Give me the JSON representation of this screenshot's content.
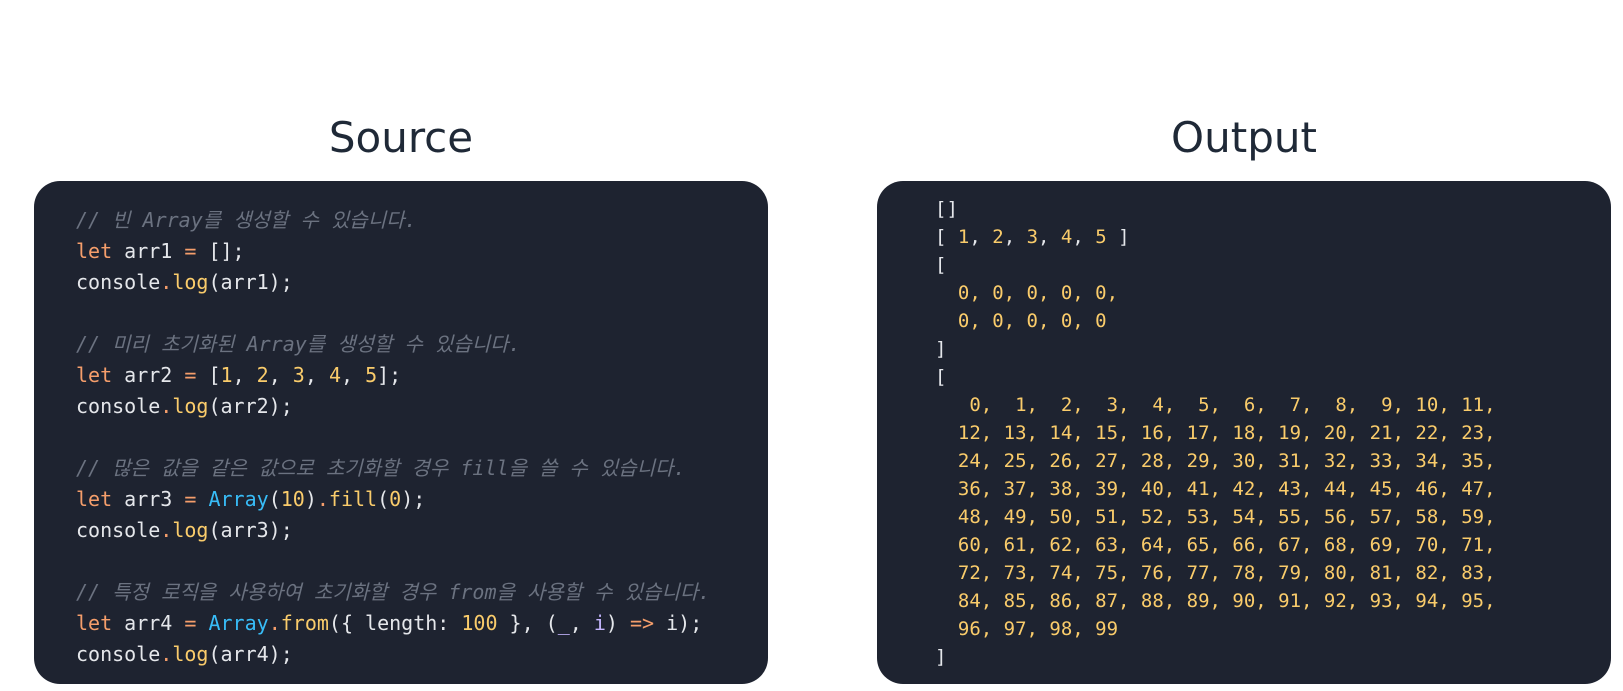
{
  "titles": {
    "source": "Source",
    "output": "Output"
  },
  "source_lines": [
    [
      {
        "t": "// 빈 Array를 생성할 수 있습니다.",
        "c": "cm"
      }
    ],
    [
      {
        "t": "let",
        "c": "kw"
      },
      {
        "t": " arr1 ",
        "c": "txt"
      },
      {
        "t": "=",
        "c": "op"
      },
      {
        "t": " [];",
        "c": "txt"
      }
    ],
    [
      {
        "t": "console",
        "c": "txt"
      },
      {
        "t": ".",
        "c": "op"
      },
      {
        "t": "log",
        "c": "fn"
      },
      {
        "t": "(arr1);",
        "c": "txt"
      }
    ],
    [],
    [
      {
        "t": "// 미리 초기화된 Array를 생성할 수 있습니다.",
        "c": "cm"
      }
    ],
    [
      {
        "t": "let",
        "c": "kw"
      },
      {
        "t": " arr2 ",
        "c": "txt"
      },
      {
        "t": "=",
        "c": "op"
      },
      {
        "t": " [",
        "c": "txt"
      },
      {
        "t": "1",
        "c": "num"
      },
      {
        "t": ", ",
        "c": "txt"
      },
      {
        "t": "2",
        "c": "num"
      },
      {
        "t": ", ",
        "c": "txt"
      },
      {
        "t": "3",
        "c": "num"
      },
      {
        "t": ", ",
        "c": "txt"
      },
      {
        "t": "4",
        "c": "num"
      },
      {
        "t": ", ",
        "c": "txt"
      },
      {
        "t": "5",
        "c": "num"
      },
      {
        "t": "];",
        "c": "txt"
      }
    ],
    [
      {
        "t": "console",
        "c": "txt"
      },
      {
        "t": ".",
        "c": "op"
      },
      {
        "t": "log",
        "c": "fn"
      },
      {
        "t": "(arr2);",
        "c": "txt"
      }
    ],
    [],
    [
      {
        "t": "// 많은 값을 같은 값으로 초기화할 경우 fill을 쓸 수 있습니다.",
        "c": "cm"
      }
    ],
    [
      {
        "t": "let",
        "c": "kw"
      },
      {
        "t": " arr3 ",
        "c": "txt"
      },
      {
        "t": "=",
        "c": "op"
      },
      {
        "t": " ",
        "c": "txt"
      },
      {
        "t": "Array",
        "c": "cls"
      },
      {
        "t": "(",
        "c": "txt"
      },
      {
        "t": "10",
        "c": "num"
      },
      {
        "t": ")",
        "c": "txt"
      },
      {
        "t": ".",
        "c": "op"
      },
      {
        "t": "fill",
        "c": "fn"
      },
      {
        "t": "(",
        "c": "txt"
      },
      {
        "t": "0",
        "c": "num"
      },
      {
        "t": ");",
        "c": "txt"
      }
    ],
    [
      {
        "t": "console",
        "c": "txt"
      },
      {
        "t": ".",
        "c": "op"
      },
      {
        "t": "log",
        "c": "fn"
      },
      {
        "t": "(arr3);",
        "c": "txt"
      }
    ],
    [],
    [
      {
        "t": "// 특정 로직을 사용하여 초기화할 경우 from을 사용할 수 있습니다.",
        "c": "cm"
      }
    ],
    [
      {
        "t": "let",
        "c": "kw"
      },
      {
        "t": " arr4 ",
        "c": "txt"
      },
      {
        "t": "=",
        "c": "op"
      },
      {
        "t": " ",
        "c": "txt"
      },
      {
        "t": "Array",
        "c": "cls"
      },
      {
        "t": ".",
        "c": "op"
      },
      {
        "t": "from",
        "c": "fn"
      },
      {
        "t": "({ length: ",
        "c": "txt"
      },
      {
        "t": "100",
        "c": "num"
      },
      {
        "t": " }, (",
        "c": "txt"
      },
      {
        "t": "_",
        "c": "var"
      },
      {
        "t": ", ",
        "c": "txt"
      },
      {
        "t": "i",
        "c": "var"
      },
      {
        "t": ") ",
        "c": "txt"
      },
      {
        "t": "=>",
        "c": "op"
      },
      {
        "t": " i);",
        "c": "txt"
      }
    ],
    [
      {
        "t": "console",
        "c": "txt"
      },
      {
        "t": ".",
        "c": "op"
      },
      {
        "t": "log",
        "c": "fn"
      },
      {
        "t": "(arr4);",
        "c": "txt"
      }
    ]
  ],
  "output_lines": [
    [
      {
        "t": "[]",
        "c": "txt"
      }
    ],
    [
      {
        "t": "[ ",
        "c": "txt"
      },
      {
        "t": "1",
        "c": "num"
      },
      {
        "t": ", ",
        "c": "txt"
      },
      {
        "t": "2",
        "c": "num"
      },
      {
        "t": ", ",
        "c": "txt"
      },
      {
        "t": "3",
        "c": "num"
      },
      {
        "t": ", ",
        "c": "txt"
      },
      {
        "t": "4",
        "c": "num"
      },
      {
        "t": ", ",
        "c": "txt"
      },
      {
        "t": "5",
        "c": "num"
      },
      {
        "t": " ]",
        "c": "txt"
      }
    ],
    [
      {
        "t": "[",
        "c": "txt"
      }
    ],
    [
      {
        "t": "  0, 0, 0, 0, 0,",
        "c": "num"
      }
    ],
    [
      {
        "t": "  0, 0, 0, 0, 0",
        "c": "num"
      }
    ],
    [
      {
        "t": "]",
        "c": "txt"
      }
    ],
    [
      {
        "t": "[",
        "c": "txt"
      }
    ],
    [
      {
        "t": "   0,  1,  2,  3,  4,  5,  6,  7,  8,  9, 10, 11,",
        "c": "num"
      }
    ],
    [
      {
        "t": "  12, 13, 14, 15, 16, 17, 18, 19, 20, 21, 22, 23,",
        "c": "num"
      }
    ],
    [
      {
        "t": "  24, 25, 26, 27, 28, 29, 30, 31, 32, 33, 34, 35,",
        "c": "num"
      }
    ],
    [
      {
        "t": "  36, 37, 38, 39, 40, 41, 42, 43, 44, 45, 46, 47,",
        "c": "num"
      }
    ],
    [
      {
        "t": "  48, 49, 50, 51, 52, 53, 54, 55, 56, 57, 58, 59,",
        "c": "num"
      }
    ],
    [
      {
        "t": "  60, 61, 62, 63, 64, 65, 66, 67, 68, 69, 70, 71,",
        "c": "num"
      }
    ],
    [
      {
        "t": "  72, 73, 74, 75, 76, 77, 78, 79, 80, 81, 82, 83,",
        "c": "num"
      }
    ],
    [
      {
        "t": "  84, 85, 86, 87, 88, 89, 90, 91, 92, 93, 94, 95,",
        "c": "num"
      }
    ],
    [
      {
        "t": "  96, 97, 98, 99",
        "c": "num"
      }
    ],
    [
      {
        "t": "]",
        "c": "txt"
      }
    ]
  ]
}
